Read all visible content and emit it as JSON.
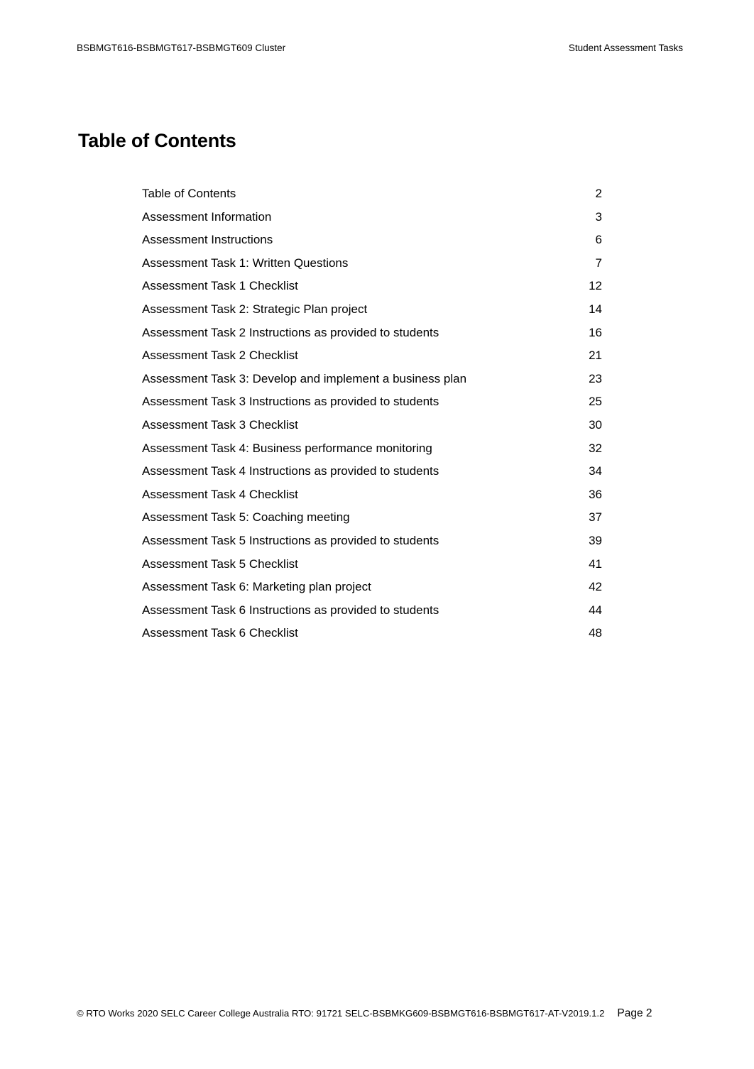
{
  "header": {
    "left": "BSBMGT616-BSBMGT617-BSBMGT609 Cluster",
    "right": "Student Assessment Tasks"
  },
  "title": "Table of Contents",
  "toc": {
    "entries": [
      {
        "label": "Table of Contents",
        "page": "2"
      },
      {
        "label": "Assessment Information",
        "page": "3"
      },
      {
        "label": "Assessment Instructions",
        "page": "6"
      },
      {
        "label": "Assessment Task 1: Written Questions",
        "page": "7"
      },
      {
        "label": "Assessment Task 1 Checklist",
        "page": "12"
      },
      {
        "label": "Assessment Task 2: Strategic Plan project",
        "page": "14"
      },
      {
        "label": "Assessment Task 2 Instructions as provided to students",
        "page": "16"
      },
      {
        "label": "Assessment Task 2 Checklist",
        "page": "21"
      },
      {
        "label": "Assessment Task 3: Develop and implement a business plan",
        "page": "23"
      },
      {
        "label": "Assessment Task 3 Instructions as provided to students",
        "page": "25"
      },
      {
        "label": "Assessment Task 3 Checklist",
        "page": "30"
      },
      {
        "label": "Assessment Task 4: Business performance monitoring",
        "page": "32"
      },
      {
        "label": "Assessment Task 4 Instructions as provided to students",
        "page": "34"
      },
      {
        "label": "Assessment Task 4 Checklist",
        "page": "36"
      },
      {
        "label": "Assessment Task 5: Coaching meeting",
        "page": "37"
      },
      {
        "label": "Assessment Task 5 Instructions as provided to students",
        "page": "39"
      },
      {
        "label": "Assessment Task 5 Checklist",
        "page": "41"
      },
      {
        "label": "Assessment Task 6: Marketing plan project",
        "page": "42"
      },
      {
        "label": "Assessment Task 6 Instructions as provided to students",
        "page": "44"
      },
      {
        "label": "Assessment Task 6 Checklist",
        "page": "48"
      }
    ]
  },
  "footer": {
    "copyright": "© RTO Works 2020  SELC Career College Australia RTO: 91721 SELC-BSBMKG609-BSBMGT616-BSBMGT617-AT-V2019.1.2",
    "page_label": "Page 2"
  }
}
